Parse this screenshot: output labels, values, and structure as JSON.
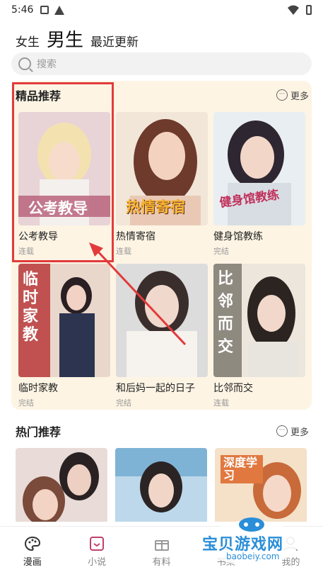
{
  "status_bar": {
    "time": "5:46"
  },
  "top_tabs": {
    "girls": "女生",
    "boys": "男生",
    "recent": "最近更新"
  },
  "search": {
    "placeholder": "搜索"
  },
  "featured": {
    "title": "精品推荐",
    "more": "更多",
    "items": [
      {
        "title": "公考教导",
        "status": "连载",
        "cover_text": "公考教导",
        "accent": "#d9879a"
      },
      {
        "title": "热情寄宿",
        "status": "连载",
        "cover_text": "热情寄宿",
        "accent": "#f2b24a"
      },
      {
        "title": "健身馆教练",
        "status": "完结",
        "cover_text": "健身馆教练",
        "accent": "#c0305a"
      },
      {
        "title": "临时家教",
        "status": "完结",
        "cover_text": "临时家教",
        "accent": "#c23a3a"
      },
      {
        "title": "和后妈一起的日子",
        "status": "完结",
        "cover_text": "",
        "accent": "#e6d2c4"
      },
      {
        "title": "比邻而交",
        "status": "连载",
        "cover_text": "比邻而交",
        "accent": "#b7b3a8"
      }
    ]
  },
  "hot": {
    "title": "热门推荐",
    "more": "更多",
    "items": [
      {
        "accent": "#c9a7a0"
      },
      {
        "accent": "#8fb7d8"
      },
      {
        "accent": "#f0c88a",
        "cover_text": "深度学习"
      }
    ]
  },
  "bottom_nav": {
    "items": [
      {
        "label": "漫画",
        "active": true
      },
      {
        "label": "小说",
        "active": false
      },
      {
        "label": "有料",
        "active": false
      },
      {
        "label": "书架",
        "active": false
      },
      {
        "label": "我的",
        "active": false
      }
    ]
  },
  "watermark": {
    "text": "宝贝游戏网",
    "url": "baobeiy.com"
  },
  "colors": {
    "panel_bg": "#fdf4e4",
    "highlight": "#e23b3b"
  }
}
